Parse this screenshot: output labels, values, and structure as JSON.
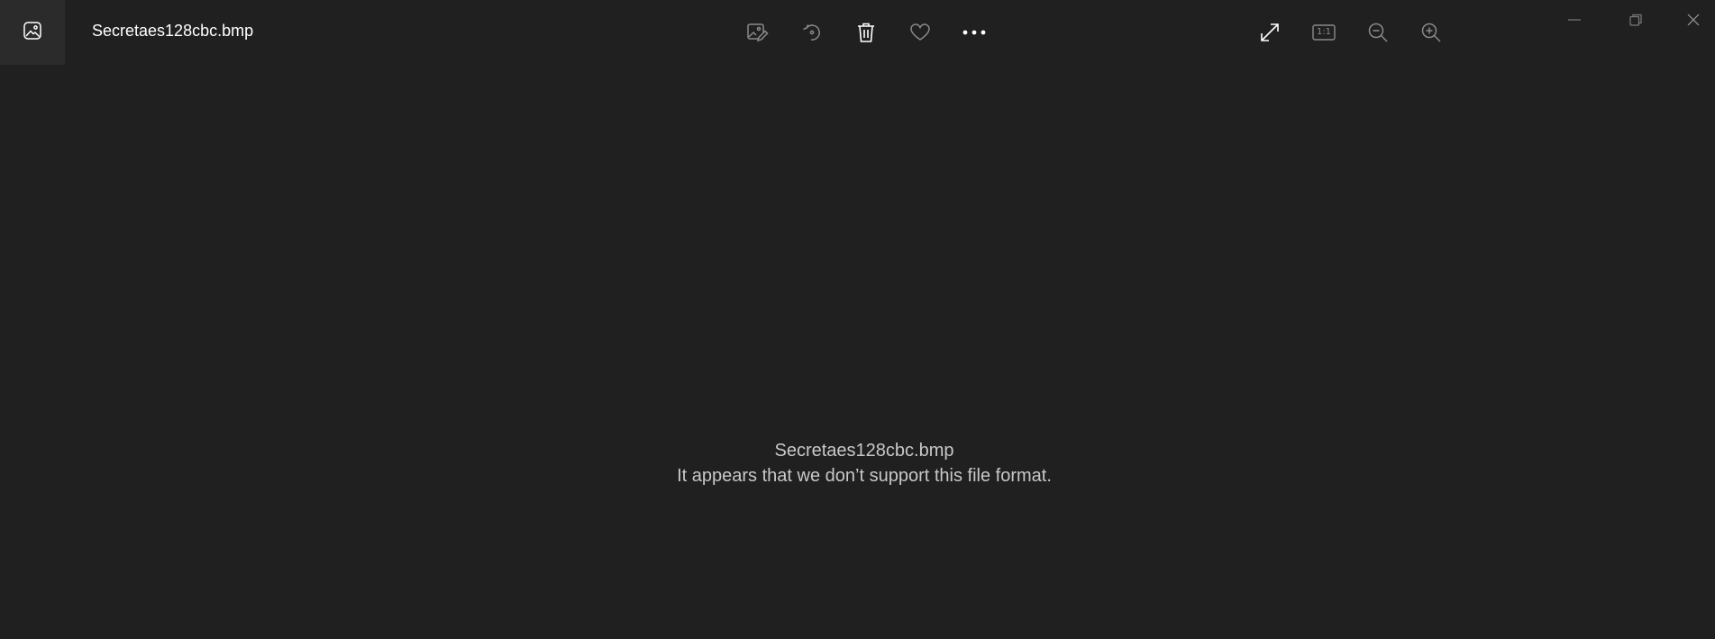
{
  "app": {
    "file_name": "Secretaes128cbc.bmp",
    "icon": "photos-app-icon"
  },
  "toolbar": {
    "left_actions": [
      {
        "name": "edit-image",
        "icon": "edit-image-icon"
      },
      {
        "name": "rotate",
        "icon": "rotate-icon"
      },
      {
        "name": "delete",
        "icon": "trash-icon"
      },
      {
        "name": "favorite",
        "icon": "heart-icon"
      },
      {
        "name": "more",
        "icon": "more-icon"
      }
    ],
    "right_actions": [
      {
        "name": "full-screen",
        "icon": "expand-icon"
      },
      {
        "name": "actual-size",
        "icon": "actual-size-icon",
        "label": "1:1"
      },
      {
        "name": "zoom-out",
        "icon": "zoom-out-icon"
      },
      {
        "name": "zoom-in",
        "icon": "zoom-in-icon"
      }
    ]
  },
  "window_controls": [
    "minimize-icon",
    "restore-icon",
    "close-icon"
  ],
  "content": {
    "file_name": "Secretaes128cbc.bmp",
    "error_message": "It appears that we don’t support this file format."
  },
  "colors": {
    "background": "#202020",
    "icon_box": "#2b2b2b",
    "icon_active": "#ffffff",
    "icon_dim": "#8a8a8a",
    "message_text": "#c8c8c8"
  }
}
